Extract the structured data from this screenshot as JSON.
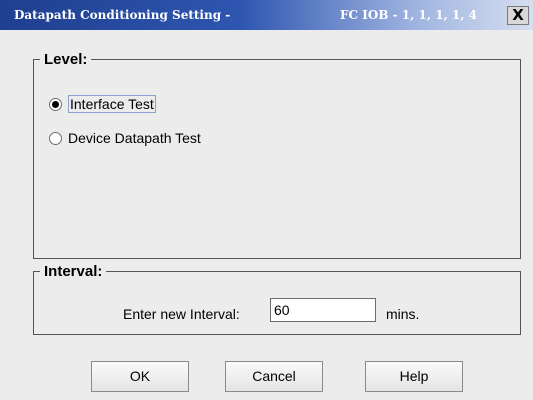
{
  "window": {
    "title_left": "Datapath Conditioning Setting -",
    "title_right": "FC IOB - 1, 1, 1, 1, 4",
    "close_label": "X"
  },
  "level": {
    "legend": "Level:",
    "options": [
      {
        "label": "Interface Test",
        "selected": true
      },
      {
        "label": "Device Datapath Test",
        "selected": false
      }
    ]
  },
  "interval": {
    "legend": "Interval:",
    "label": "Enter new Interval:",
    "value": "60",
    "unit": "mins."
  },
  "buttons": {
    "ok": "OK",
    "cancel": "Cancel",
    "help": "Help"
  }
}
